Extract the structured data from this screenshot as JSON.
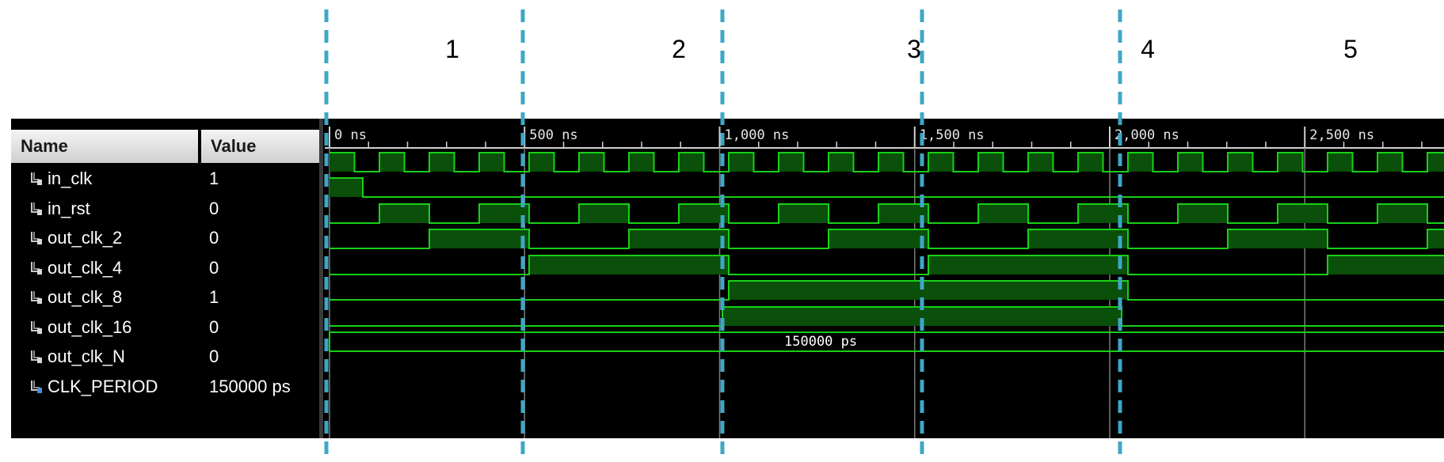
{
  "phases": [
    "1",
    "2",
    "3",
    "4",
    "5"
  ],
  "header": {
    "name_label": "Name",
    "value_label": "Value"
  },
  "timeline": {
    "ticks": [
      "0 ns",
      "500 ns",
      "1,000 ns",
      "1,500 ns",
      "2,000 ns",
      "2,500 ns"
    ],
    "ns_per_tick": 500
  },
  "signals": [
    {
      "name": "in_clk",
      "value": "1",
      "icon": "signal-icon"
    },
    {
      "name": "in_rst",
      "value": "0",
      "icon": "signal-icon"
    },
    {
      "name": "out_clk_2",
      "value": "0",
      "icon": "signal-icon"
    },
    {
      "name": "out_clk_4",
      "value": "0",
      "icon": "signal-icon"
    },
    {
      "name": "out_clk_8",
      "value": "1",
      "icon": "signal-icon"
    },
    {
      "name": "out_clk_16",
      "value": "0",
      "icon": "signal-icon"
    },
    {
      "name": "out_clk_N",
      "value": "0",
      "icon": "signal-icon"
    },
    {
      "name": "CLK_PERIOD",
      "value": "150000 ps",
      "icon": "constant-icon"
    }
  ],
  "bus_value": "150000 ps",
  "colors": {
    "wave": "#17d017",
    "wave_fill": "#0a4f0a",
    "marker": "#3ea7c6",
    "grid": "#7a7a7a"
  }
}
